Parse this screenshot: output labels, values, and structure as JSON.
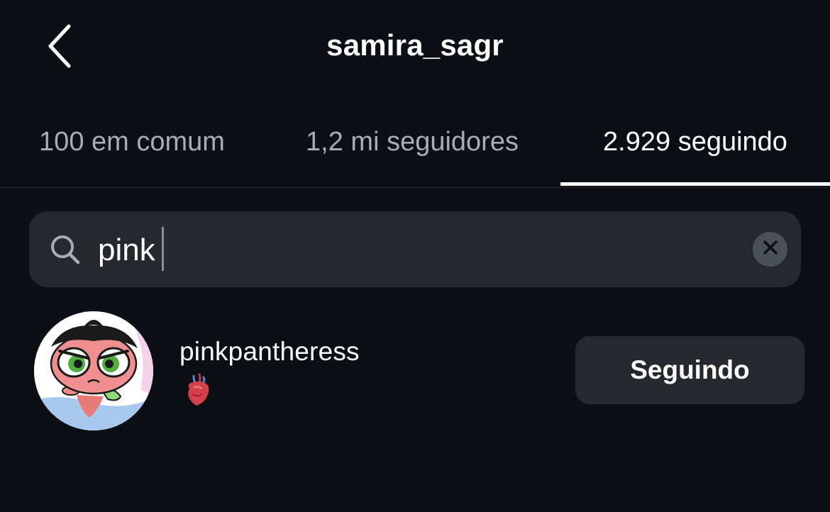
{
  "header": {
    "title": "samira_sagr",
    "back_icon": "chevron-left-icon"
  },
  "tabs": [
    {
      "label": "100 em comum",
      "active": false
    },
    {
      "label": "1,2 mi seguidores",
      "active": false
    },
    {
      "label": "2.929 seguindo",
      "active": true
    }
  ],
  "search": {
    "value": "pink",
    "icon": "search-icon",
    "clear_icon": "clear-icon"
  },
  "results": [
    {
      "username": "pinkpantheress",
      "subtitle_icon": "anatomical-heart-icon",
      "button_label": "Seguindo"
    }
  ],
  "colors": {
    "background": "#0c1014",
    "surface": "#25292e",
    "text_primary": "#ffffff",
    "text_secondary": "#a8adb3"
  }
}
